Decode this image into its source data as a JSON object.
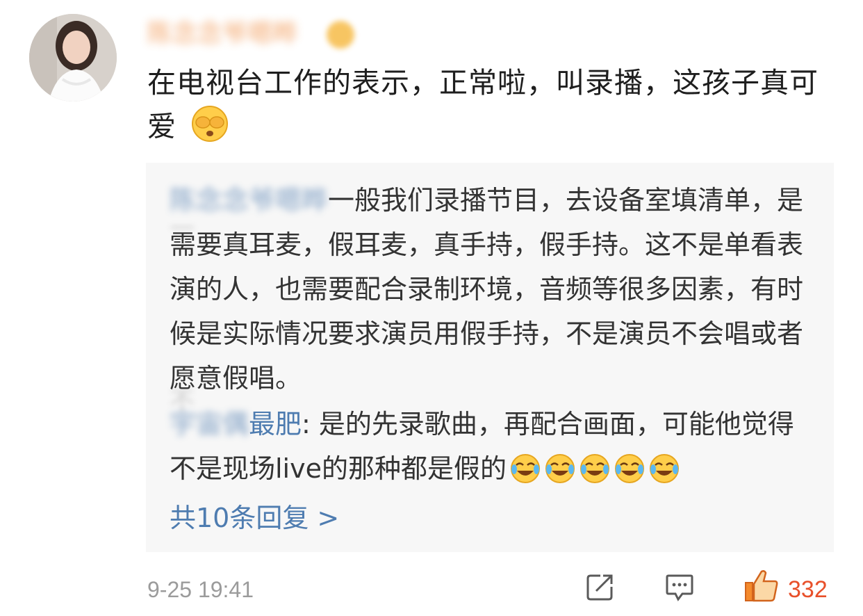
{
  "comment": {
    "username": "陈念念爷嗯晔",
    "text": "在电视台工作的表示，正常啦，叫录播，这孩子真可爱",
    "emoji": "shy-cover-face-emoji"
  },
  "replies": [
    {
      "author": "陈念念爷嗯晔",
      "separator": "：",
      "text": "一般我们录播节目，去设备室填清单，是需要真耳麦，假耳麦，真手持，假手持。这不是单看表演的人，也需要配合录制环境，音频等很多因素，有时候是实际情况要求演员用假手持，不是演员不会唱或者愿意假唱。"
    },
    {
      "author_blurred": "宇宙偶",
      "author_visible": "最肥",
      "separator": ": ",
      "text": "是的先录歌曲，再配合画面，可能他觉得不是现场live的那种都是假的",
      "emoji": "laugh-cry-emoji",
      "emoji_count": 5
    }
  ],
  "more_replies_label": "共10条回复 >",
  "timestamp": "9-25 19:41",
  "actions": {
    "share_icon": "share-icon",
    "comment_icon": "comment-icon",
    "like_icon": "thumbs-up-icon",
    "like_count": "332"
  },
  "colors": {
    "link": "#4e7cb0",
    "like": "#e8502a",
    "reply_bg": "#f7f7f7"
  }
}
